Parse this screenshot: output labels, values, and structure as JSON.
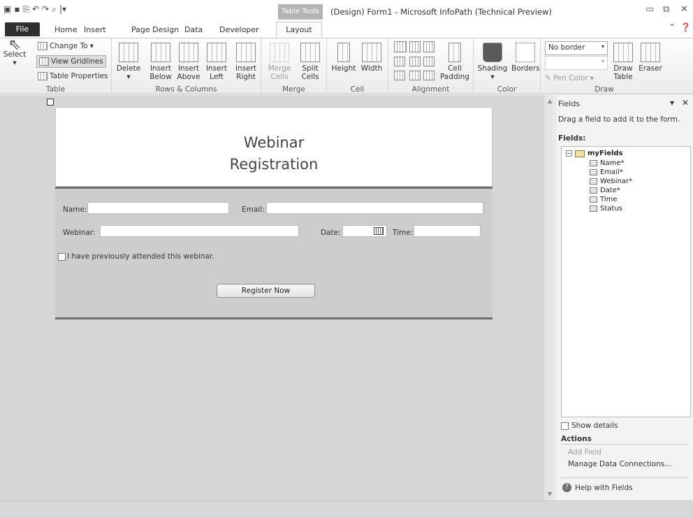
{
  "qat": {
    "icons": [
      "app-icon",
      "save-icon",
      "publish-icon",
      "undo-icon",
      "redo-icon",
      "preview-icon",
      "customize-qat-icon"
    ]
  },
  "window": {
    "context_tab": "Table Tools",
    "title": "(Design) Form1 - Microsoft InfoPath (Technical Preview)",
    "controls": [
      "minimize-icon",
      "restore-icon",
      "close-icon"
    ]
  },
  "tabs": [
    {
      "label": "File"
    },
    {
      "label": "Home"
    },
    {
      "label": "Insert"
    },
    {
      "label": "Page Design"
    },
    {
      "label": "Data"
    },
    {
      "label": "Developer"
    },
    {
      "label": "Layout"
    }
  ],
  "ribbon": {
    "table": {
      "label": "Table",
      "select": "Select",
      "change_to": "Change To",
      "view_gridlines": "View Gridlines",
      "table_properties": "Table Properties"
    },
    "rows_columns": {
      "label": "Rows & Columns",
      "delete": "Delete",
      "insert_below": [
        "Insert",
        "Below"
      ],
      "insert_above": [
        "Insert",
        "Above"
      ],
      "insert_left": [
        "Insert",
        "Left"
      ],
      "insert_right": [
        "Insert",
        "Right"
      ]
    },
    "merge": {
      "label": "Merge",
      "merge_cells": [
        "Merge",
        "Cells"
      ],
      "split_cells": [
        "Split",
        "Cells"
      ]
    },
    "cell": {
      "label": "Cell",
      "height": "Height",
      "width": "Width"
    },
    "alignment": {
      "label": "Alignment",
      "cell_padding": [
        "Cell",
        "Padding"
      ]
    },
    "color": {
      "label": "Color",
      "shading": "Shading",
      "borders": "Borders"
    },
    "draw": {
      "label": "Draw",
      "border_style": "No border",
      "pen_color": "Pen Color",
      "draw_table": [
        "Draw",
        "Table"
      ],
      "eraser": "Eraser"
    }
  },
  "form": {
    "title_line1": "Webinar",
    "title_line2": "Registration",
    "name_label": "Name:",
    "email_label": "Email:",
    "webinar_label": "Webinar:",
    "date_label": "Date:",
    "time_label": "Time:",
    "checkbox_label": "I have previously attended this webinar.",
    "register_button": "Register Now"
  },
  "fields_pane": {
    "title": "Fields",
    "instruction": "Drag a field to add it to the form.",
    "fields_heading": "Fields:",
    "root": "myFields",
    "items": [
      "Name*",
      "Email*",
      "Webinar*",
      "Date*",
      "Time",
      "Status"
    ],
    "show_details": "Show details",
    "actions_heading": "Actions",
    "add_field": "Add Field",
    "manage_connections": "Manage Data Connections...",
    "help": "Help with Fields"
  }
}
